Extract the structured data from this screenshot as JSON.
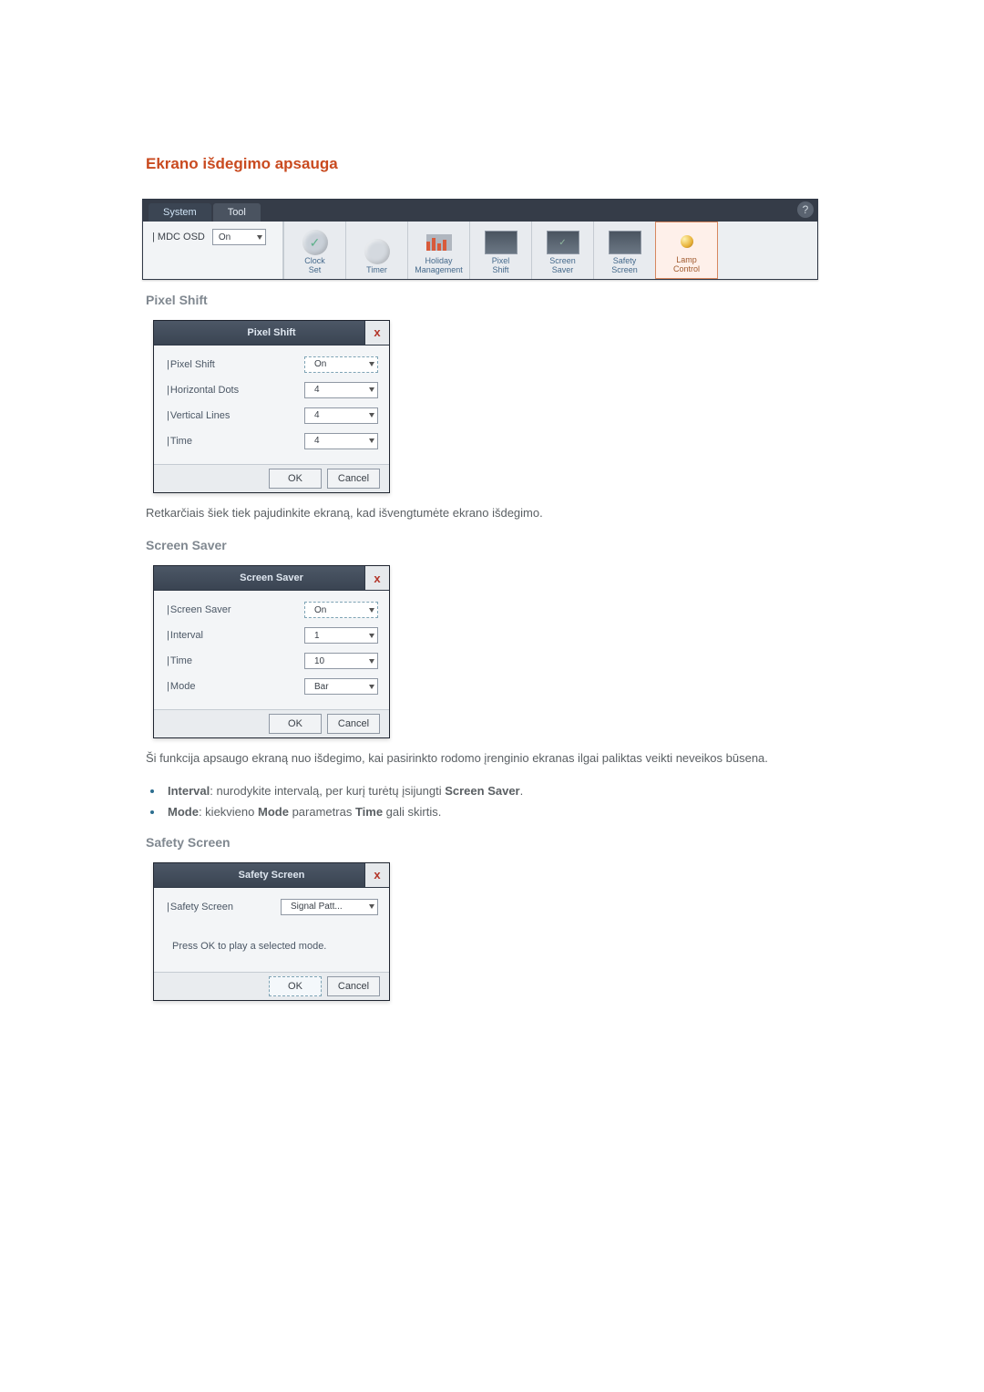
{
  "heading": "Ekrano išdegimo apsauga",
  "toolbar": {
    "tabs": {
      "system": "System",
      "tool": "Tool"
    },
    "mdc_osd_label": "MDC OSD",
    "mdc_osd_value": "On",
    "items": [
      {
        "label": "Clock\nSet"
      },
      {
        "label": "Timer"
      },
      {
        "label": "Holiday\nManagement"
      },
      {
        "label": "Pixel\nShift"
      },
      {
        "label": "Screen\nSaver"
      },
      {
        "label": "Safety\nScreen"
      },
      {
        "label": "Lamp\nControl"
      }
    ]
  },
  "pixel_shift_heading": "Pixel Shift",
  "pixel_shift_dialog": {
    "title": "Pixel Shift",
    "rows": [
      {
        "label": "Pixel Shift",
        "value": "On"
      },
      {
        "label": "Horizontal Dots",
        "value": "4"
      },
      {
        "label": "Vertical Lines",
        "value": "4"
      },
      {
        "label": "Time",
        "value": "4"
      }
    ],
    "ok": "OK",
    "cancel": "Cancel"
  },
  "pixel_shift_body": "Retkarčiais šiek tiek pajudinkite ekraną, kad išvengtumėte ekrano išdegimo.",
  "screen_saver_heading": "Screen Saver",
  "screen_saver_dialog": {
    "title": "Screen Saver",
    "rows": [
      {
        "label": "Screen Saver",
        "value": "On"
      },
      {
        "label": "Interval",
        "value": "1"
      },
      {
        "label": "Time",
        "value": "10"
      },
      {
        "label": "Mode",
        "value": "Bar"
      }
    ],
    "ok": "OK",
    "cancel": "Cancel"
  },
  "screen_saver_body": "Ši funkcija apsaugo ekraną nuo išdegimo, kai pasirinkto rodomo įrenginio ekranas ilgai paliktas veikti neveikos būsena.",
  "bullets": {
    "interval_strong": "Interval",
    "interval_text": ": nurodykite intervalą, per kurį turėtų įsijungti ",
    "interval_end_strong": "Screen Saver",
    "mode_strong": "Mode",
    "mode_text1": ": kiekvieno ",
    "mode_strong2": "Mode",
    "mode_text2": " parametras ",
    "mode_strong3": "Time",
    "mode_text3": " gali skirtis."
  },
  "safety_screen_heading": "Safety Screen",
  "safety_screen_dialog": {
    "title": "Safety Screen",
    "row": {
      "label": "Safety Screen",
      "value": "Signal Patt..."
    },
    "msg": "Press OK to play a selected mode.",
    "ok": "OK",
    "cancel": "Cancel"
  }
}
